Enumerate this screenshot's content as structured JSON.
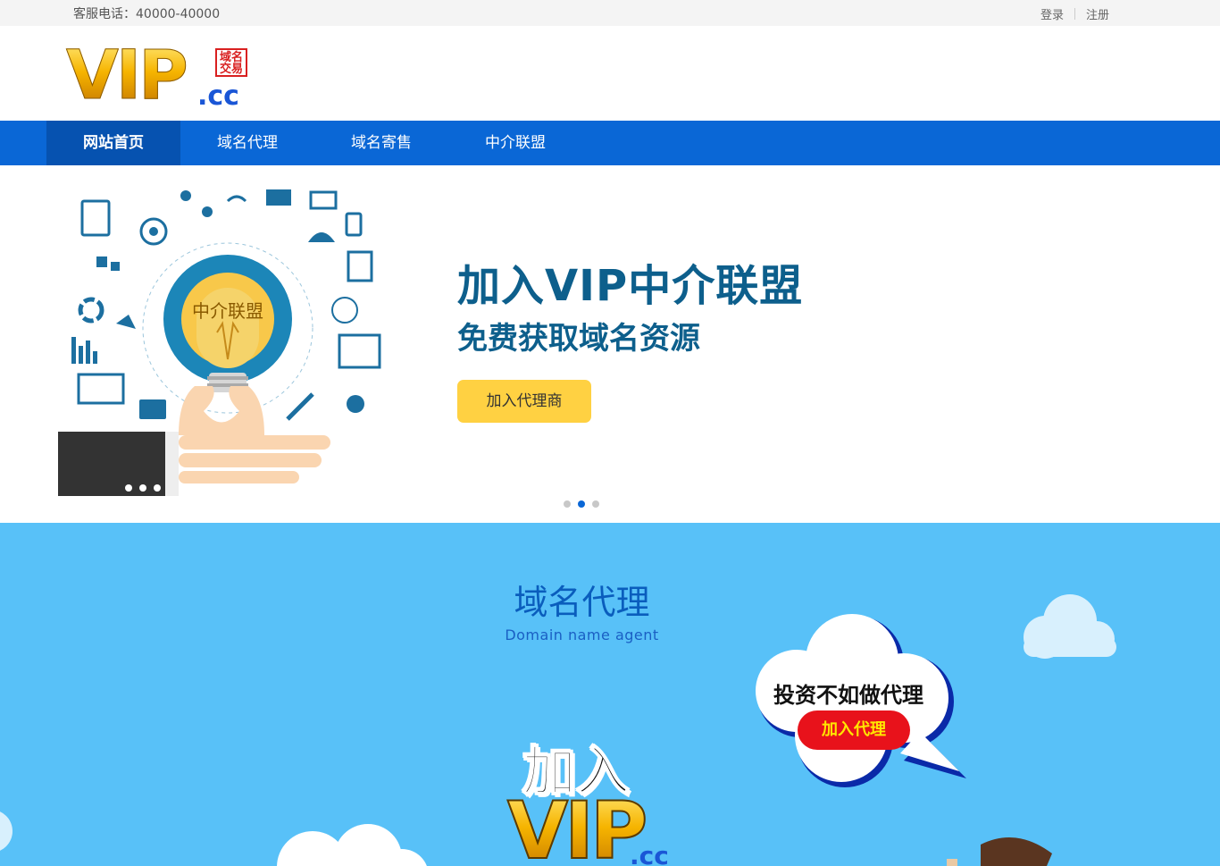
{
  "topbar": {
    "phone": "客服电话：40000-40000",
    "login": "登录",
    "register": "注册"
  },
  "logo": {
    "vip": "VIP",
    "stamp": "域名\n交易",
    "cc": ".cc"
  },
  "nav": {
    "items": [
      {
        "label": "网站首页",
        "active": true
      },
      {
        "label": "域名代理",
        "active": false
      },
      {
        "label": "域名寄售",
        "active": false
      },
      {
        "label": "中介联盟",
        "active": false
      }
    ]
  },
  "banner": {
    "bulb_text": "中介联盟",
    "title": "加入VIP中介联盟",
    "subtitle": "免费获取域名资源",
    "cta": "加入代理商",
    "slides": 3,
    "active_slide": 2
  },
  "agent": {
    "title": "域名代理",
    "subtitle": "Domain name agent",
    "join_text": "加入",
    "vip_text": "VIP",
    "cc_text": ".cc",
    "bubble_text": "投资不如做代理",
    "bubble_button": "加入代理"
  },
  "colors": {
    "nav_bg": "#0a67d6",
    "nav_active": "#0652b0",
    "cta_yellow": "#ffd142",
    "section_blue": "#58c1f8",
    "title_blue": "#0d5f8c",
    "red_button": "#e8121b"
  }
}
